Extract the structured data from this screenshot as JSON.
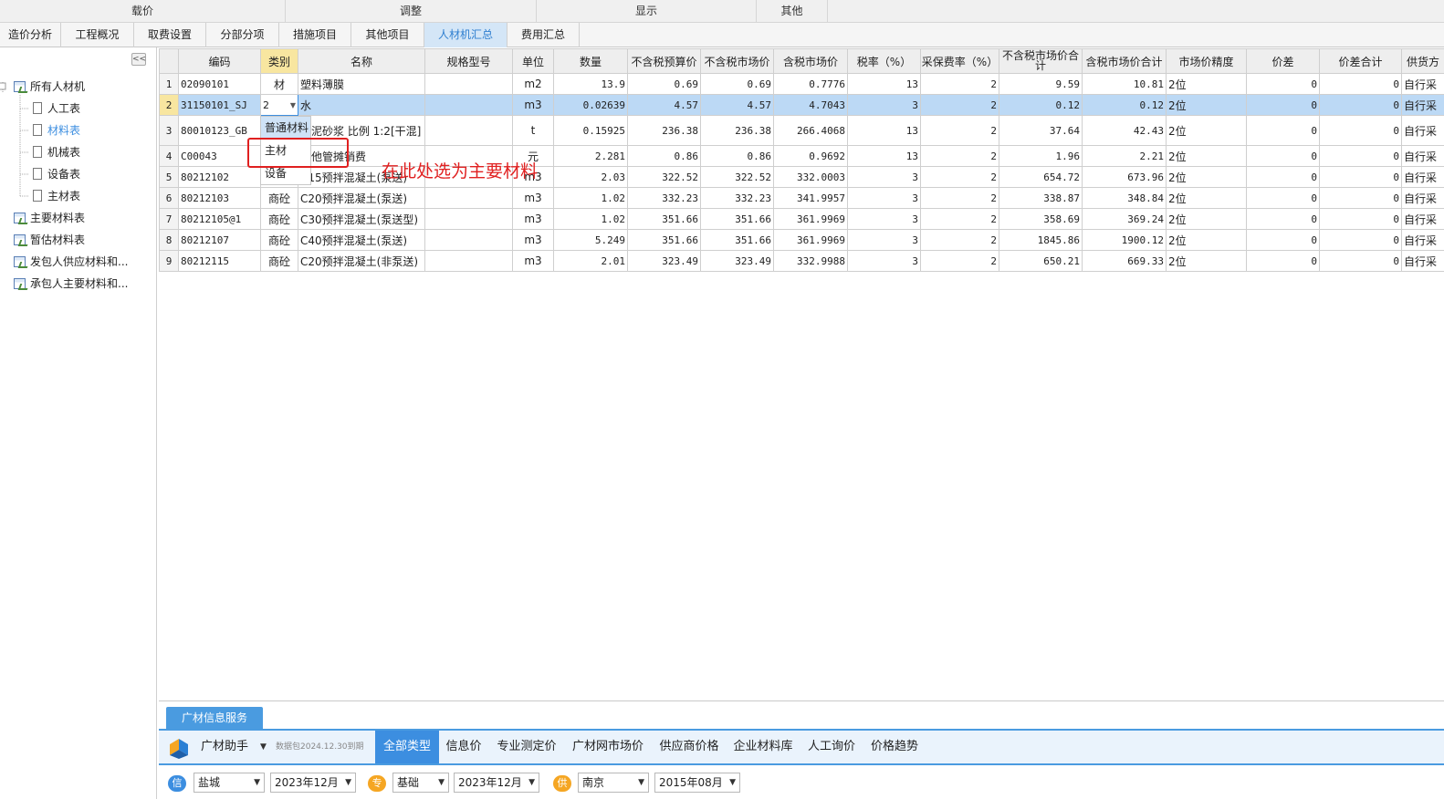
{
  "ribbon": {
    "groups": [
      "载价",
      "调整",
      "显示",
      "其他"
    ]
  },
  "tabs": [
    "造价分析",
    "工程概况",
    "取费设置",
    "分部分项",
    "措施项目",
    "其他项目",
    "人材机汇总",
    "费用汇总"
  ],
  "active_tab": "人材机汇总",
  "tree": {
    "collapse_label": "<<",
    "root": "所有人材机",
    "children": [
      "人工表",
      "材料表",
      "机械表",
      "设备表",
      "主材表"
    ],
    "selected": "材料表",
    "others": [
      "主要材料表",
      "暂估材料表",
      "发包人供应材料和...",
      "承包人主要材料和..."
    ]
  },
  "table": {
    "headers": [
      "",
      "编码",
      "类别",
      "名称",
      "规格型号",
      "单位",
      "数量",
      "不含税预算价",
      "不含税市场价",
      "含税市场价",
      "税率（%）",
      "采保费率（%）",
      "不含税市场价合计",
      "含税市场价合计",
      "市场价精度",
      "价差",
      "价差合计",
      "供货方"
    ],
    "rows": [
      [
        "1",
        "02090101",
        "材",
        "塑料薄膜",
        "",
        "m2",
        "13.9",
        "0.69",
        "0.69",
        "0.7776",
        "13",
        "2",
        "9.59",
        "10.81",
        "2位",
        "0",
        "0",
        "自行采"
      ],
      [
        "2",
        "31150101_SJ",
        "2",
        "水",
        "",
        "m3",
        "0.02639",
        "4.57",
        "4.57",
        "4.7043",
        "3",
        "2",
        "0.12",
        "0.12",
        "2位",
        "0",
        "0",
        "自行采"
      ],
      [
        "3",
        "80010123_GB",
        "",
        "水泥砂浆 比例 1:2[干混]",
        "",
        "t",
        "0.15925",
        "236.38",
        "236.38",
        "266.4068",
        "13",
        "2",
        "37.64",
        "42.43",
        "2位",
        "0",
        "0",
        "自行采"
      ],
      [
        "4",
        "C00043",
        "",
        "其他管摊销费",
        "",
        "元",
        "2.281",
        "0.86",
        "0.86",
        "0.9692",
        "13",
        "2",
        "1.96",
        "2.21",
        "2位",
        "0",
        "0",
        "自行采"
      ],
      [
        "5",
        "80212102",
        "",
        "C15预拌混凝土(泵送)",
        "",
        "m3",
        "2.03",
        "322.52",
        "322.52",
        "332.0003",
        "3",
        "2",
        "654.72",
        "673.96",
        "2位",
        "0",
        "0",
        "自行采"
      ],
      [
        "6",
        "80212103",
        "商砼",
        "C20预拌混凝土(泵送)",
        "",
        "m3",
        "1.02",
        "332.23",
        "332.23",
        "341.9957",
        "3",
        "2",
        "338.87",
        "348.84",
        "2位",
        "0",
        "0",
        "自行采"
      ],
      [
        "7",
        "80212105@1",
        "商砼",
        "C30预拌混凝土(泵送型)",
        "",
        "m3",
        "1.02",
        "351.66",
        "351.66",
        "361.9969",
        "3",
        "2",
        "358.69",
        "369.24",
        "2位",
        "0",
        "0",
        "自行采"
      ],
      [
        "8",
        "80212107",
        "商砼",
        "C40预拌混凝土(泵送)",
        "",
        "m3",
        "5.249",
        "351.66",
        "351.66",
        "361.9969",
        "3",
        "2",
        "1845.86",
        "1900.12",
        "2位",
        "0",
        "0",
        "自行采"
      ],
      [
        "9",
        "80212115",
        "商砼",
        "C20预拌混凝土(非泵送)",
        "",
        "m3",
        "2.01",
        "323.49",
        "323.49",
        "332.9988",
        "3",
        "2",
        "650.21",
        "669.33",
        "2位",
        "0",
        "0",
        "自行采"
      ]
    ],
    "selected_row": 2
  },
  "dropdown": {
    "options": [
      "普通材料",
      "主材",
      "设备"
    ],
    "hover": "普通材料"
  },
  "annotation": "在此处选为主要材料",
  "bottom": {
    "service_tab": "广材信息服务",
    "assistant": "广材助手",
    "data_pack": "数据包2024.12.30到期",
    "links": [
      "全部类型",
      "信息价",
      "专业测定价",
      "广材网市场价",
      "供应商价格",
      "企业材料库",
      "人工询价",
      "价格趋势"
    ],
    "active_link": "全部类型",
    "filters": {
      "badge1": "信",
      "city1": "盐城",
      "date1": "2023年12月",
      "badge2": "专",
      "type2": "基础",
      "date2": "2023年12月",
      "badge3": "供",
      "city3": "南京",
      "date3": "2015年08月"
    }
  },
  "colors": {
    "accent": "#3c8ee0",
    "annotation": "#e02020",
    "selected_row": "#bcd9f5",
    "badge_orange": "#f5a623",
    "badge_blue": "#3c8ee0"
  }
}
